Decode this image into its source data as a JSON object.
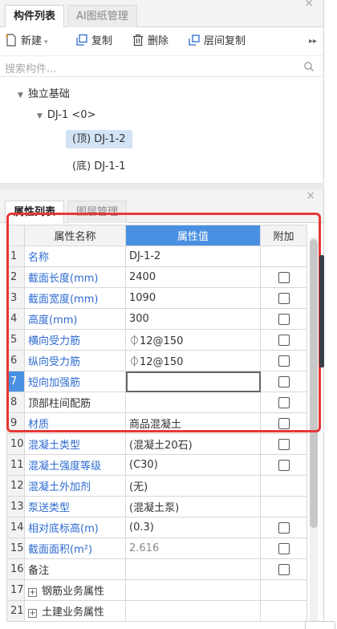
{
  "top_panel": {
    "tabs": [
      {
        "label": "构件列表"
      },
      {
        "label": "AI图纸管理"
      }
    ],
    "close": "×",
    "toolbar": {
      "new_label": "新建",
      "copy_label": "复制",
      "delete_label": "删除",
      "floor_copy_label": "层间复制",
      "more": "▸▸"
    },
    "search": {
      "placeholder": "搜索构件..."
    },
    "tree": {
      "root": "独立基础",
      "child": "DJ-1 <0>",
      "leaves": [
        "(顶) DJ-1-2",
        "(底) DJ-1-1"
      ]
    }
  },
  "bottom_panel": {
    "tabs": [
      {
        "label": "属性列表"
      },
      {
        "label": "图层管理"
      }
    ],
    "close": "×",
    "columns": {
      "name": "属性名称",
      "value": "属性值",
      "extra": "附加"
    },
    "rows": [
      {
        "num": "1",
        "name": "名称",
        "value": "DJ-1-2",
        "checkbox": false
      },
      {
        "num": "2",
        "name": "截面长度(mm)",
        "value": "2400",
        "checkbox": true
      },
      {
        "num": "3",
        "name": "截面宽度(mm)",
        "value": "1090",
        "checkbox": true
      },
      {
        "num": "4",
        "name": "高度(mm)",
        "value": "300",
        "checkbox": true
      },
      {
        "num": "5",
        "name": "横向受力筋",
        "value": "⏀12@150",
        "checkbox": true
      },
      {
        "num": "6",
        "name": "纵向受力筋",
        "value": "⏀12@150",
        "checkbox": true
      },
      {
        "num": "7",
        "name": "短向加强筋",
        "value": "",
        "checkbox": true
      },
      {
        "num": "8",
        "name": "顶部柱间配筋",
        "value": "",
        "checkbox": true
      },
      {
        "num": "9",
        "name": "材质",
        "value": "商品混凝土",
        "checkbox": true
      },
      {
        "num": "10",
        "name": "混凝土类型",
        "value": "(混凝土20石)",
        "checkbox": true
      },
      {
        "num": "11",
        "name": "混凝土强度等级",
        "value": "(C30)",
        "checkbox": true
      },
      {
        "num": "12",
        "name": "混凝土外加剂",
        "value": "(无)",
        "checkbox": false
      },
      {
        "num": "13",
        "name": "泵送类型",
        "value": "(混凝土泵)",
        "checkbox": false
      },
      {
        "num": "14",
        "name": "相对底标高(m)",
        "value": "(0.3)",
        "checkbox": true
      },
      {
        "num": "15",
        "name": "截面面积(m²)",
        "value": "2.616",
        "checkbox": true
      },
      {
        "num": "16",
        "name": "备注",
        "value": "",
        "checkbox": true
      },
      {
        "num": "17",
        "name": "钢筋业务属性",
        "value": "",
        "checkbox": false
      },
      {
        "num": "21",
        "name": "土建业务属性",
        "value": "",
        "checkbox": false
      }
    ]
  },
  "colors": {
    "accent": "#4a90e2",
    "highlight_box": "#e53935",
    "link_text": "#2d6bd1",
    "selection": "#d3e3f6"
  }
}
